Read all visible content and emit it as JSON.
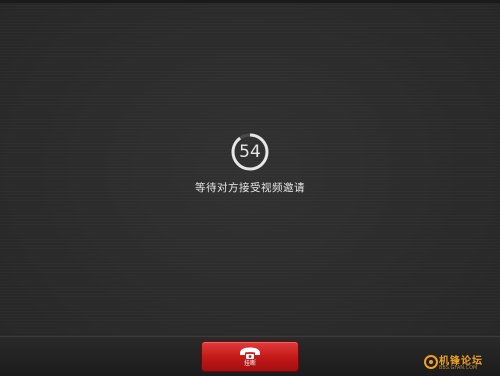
{
  "call": {
    "countdown": "54",
    "countdown_fraction": 0.9,
    "status": "等待对方接受视频邀请"
  },
  "actions": {
    "hangup_label": "挂断",
    "hangup_icon": "phone-hangup-icon"
  },
  "watermark": {
    "text": "机锋论坛",
    "site": "BBS.GFAN.COM"
  },
  "colors": {
    "background": "#2b2b2b",
    "hangup": "#c21818",
    "text": "#e8e8e8",
    "watermark": "#f0a020"
  }
}
